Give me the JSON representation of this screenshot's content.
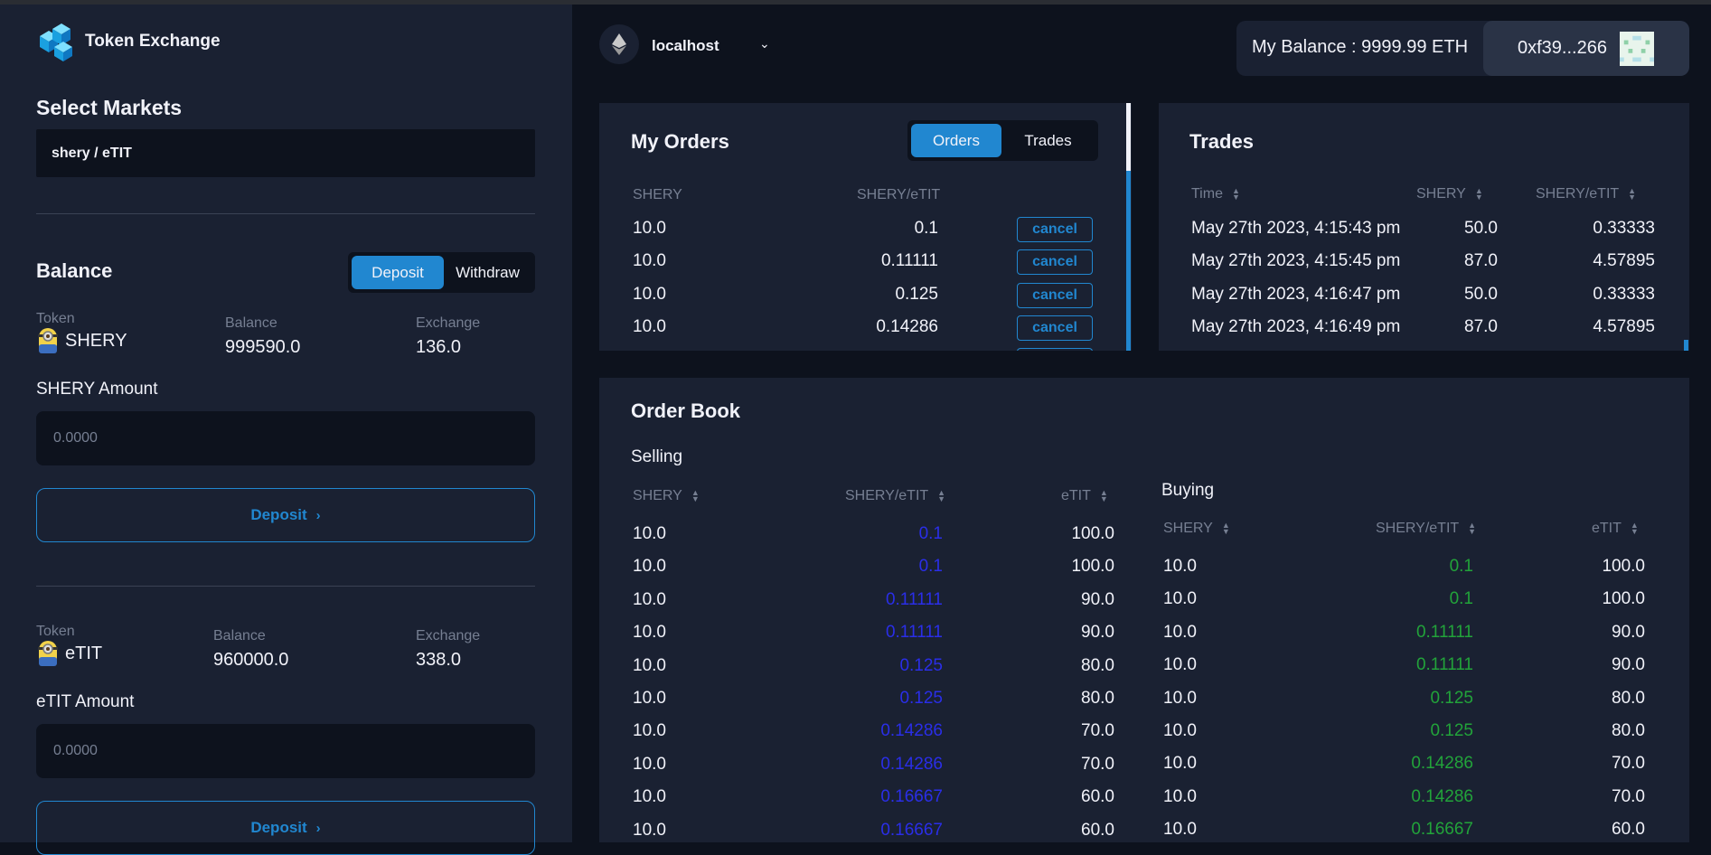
{
  "brand": {
    "title": "Token Exchange"
  },
  "markets": {
    "heading": "Select Markets",
    "selected": "shery / eTIT"
  },
  "balance": {
    "heading": "Balance",
    "tabs": [
      "Deposit",
      "Withdraw"
    ],
    "active_tab": "Deposit",
    "token1": {
      "token_label": "Token",
      "symbol": "SHERY",
      "balance_label": "Balance",
      "balance": "999590.0",
      "exchange_label": "Exchange",
      "exchange": "136.0",
      "amount_label": "SHERY Amount",
      "placeholder": "0.0000",
      "button": "Deposit"
    },
    "token2": {
      "token_label": "Token",
      "symbol": "eTIT",
      "balance_label": "Balance",
      "balance": "960000.0",
      "exchange_label": "Exchange",
      "exchange": "338.0",
      "amount_label": "eTIT Amount",
      "placeholder": "0.0000",
      "button": "Deposit"
    }
  },
  "header": {
    "network": "localhost",
    "balance_text": "My Balance : 9999.99 ETH",
    "account": "0xf39...266"
  },
  "my_orders": {
    "title": "My Orders",
    "tabs": [
      "Orders",
      "Trades"
    ],
    "active_tab": "Orders",
    "columns": [
      "SHERY",
      "SHERY/eTIT"
    ],
    "cancel_label": "cancel",
    "rows": [
      [
        "10.0",
        "0.1"
      ],
      [
        "10.0",
        "0.11111"
      ],
      [
        "10.0",
        "0.125"
      ],
      [
        "10.0",
        "0.14286"
      ]
    ]
  },
  "trades": {
    "title": "Trades",
    "columns": [
      "Time",
      "SHERY",
      "SHERY/eTIT"
    ],
    "rows": [
      [
        "May 27th 2023, 4:15:43 pm",
        "50.0",
        "0.33333"
      ],
      [
        "May 27th 2023, 4:15:45 pm",
        "87.0",
        "4.57895"
      ],
      [
        "May 27th 2023, 4:16:47 pm",
        "50.0",
        "0.33333"
      ],
      [
        "May 27th 2023, 4:16:49 pm",
        "87.0",
        "4.57895"
      ]
    ]
  },
  "order_book": {
    "title": "Order Book",
    "selling": {
      "heading": "Selling",
      "columns": [
        "SHERY",
        "SHERY/eTIT",
        "eTIT"
      ],
      "price_color": "#2a2ee8",
      "rows": [
        [
          "10.0",
          "0.1",
          "100.0"
        ],
        [
          "10.0",
          "0.1",
          "100.0"
        ],
        [
          "10.0",
          "0.11111",
          "90.0"
        ],
        [
          "10.0",
          "0.11111",
          "90.0"
        ],
        [
          "10.0",
          "0.125",
          "80.0"
        ],
        [
          "10.0",
          "0.125",
          "80.0"
        ],
        [
          "10.0",
          "0.14286",
          "70.0"
        ],
        [
          "10.0",
          "0.14286",
          "70.0"
        ],
        [
          "10.0",
          "0.16667",
          "60.0"
        ],
        [
          "10.0",
          "0.16667",
          "60.0"
        ]
      ]
    },
    "buying": {
      "heading": "Buying",
      "columns": [
        "SHERY",
        "SHERY/eTIT",
        "eTIT"
      ],
      "price_color": "#22a33a",
      "rows": [
        [
          "10.0",
          "0.1",
          "100.0"
        ],
        [
          "10.0",
          "0.1",
          "100.0"
        ],
        [
          "10.0",
          "0.11111",
          "90.0"
        ],
        [
          "10.0",
          "0.11111",
          "90.0"
        ],
        [
          "10.0",
          "0.125",
          "80.0"
        ],
        [
          "10.0",
          "0.125",
          "80.0"
        ],
        [
          "10.0",
          "0.14286",
          "70.0"
        ],
        [
          "10.0",
          "0.14286",
          "70.0"
        ],
        [
          "10.0",
          "0.16667",
          "60.0"
        ]
      ]
    }
  },
  "colors": {
    "accent": "#2187d0",
    "panel": "#1a2132",
    "background": "#0d121d",
    "muted": "#767f92"
  }
}
